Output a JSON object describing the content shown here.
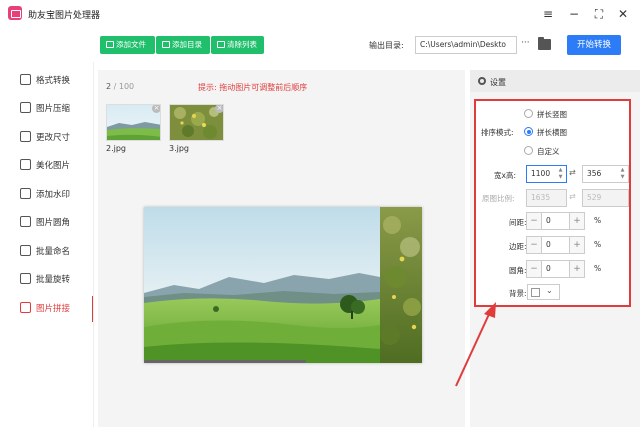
{
  "app": {
    "title": "助友宝图片处理器"
  },
  "window": {
    "menu_icon": "≡",
    "minimize_icon": "−",
    "maximize_icon": "⛶",
    "close_icon": "✕"
  },
  "sidebar": {
    "items": [
      {
        "label": "格式转换",
        "icon": "refresh-icon"
      },
      {
        "label": "图片压缩",
        "icon": "compress-icon"
      },
      {
        "label": "更改尺寸",
        "icon": "resize-icon"
      },
      {
        "label": "美化图片",
        "icon": "beautify-icon"
      },
      {
        "label": "添加水印",
        "icon": "watermark-icon"
      },
      {
        "label": "图片圆角",
        "icon": "rounded-corner-icon"
      },
      {
        "label": "批量命名",
        "icon": "rename-icon"
      },
      {
        "label": "批量旋转",
        "icon": "rotate-icon"
      },
      {
        "label": "图片拼接",
        "icon": "stitch-icon",
        "active": true
      }
    ]
  },
  "toolbar": {
    "add_file": "添加文件",
    "add_folder": "添加目录",
    "clear_list": "清除列表",
    "output_label": "输出目录:",
    "output_path": "C:\\Users\\admin\\Deskto",
    "more": "···",
    "start": "开始转换"
  },
  "main": {
    "count_current": "2",
    "count_total": " / 100",
    "hint": "提示: 拖动图片可调整前后顺序",
    "thumbs": [
      {
        "name": "2.jpg"
      },
      {
        "name": "3.jpg"
      }
    ]
  },
  "settings": {
    "title": "设置",
    "order_label": "排序模式:",
    "options": [
      "拼长竖图",
      "拼长横图",
      "自定义"
    ],
    "selected_option": "拼长横图",
    "size_label": "宽x高:",
    "width": "1100",
    "height": "356",
    "ratio_label": "原图比例:",
    "ratio_width": "1635",
    "ratio_height": "529",
    "spacing_label": "间距:",
    "spacing": "0",
    "margin_label": "边距:",
    "margin": "0",
    "radius_label": "圆角:",
    "radius": "0",
    "percent": "%",
    "background_label": "背景:",
    "background_color": "#ffffff"
  },
  "colors": {
    "accent_green": "#1fbf6b",
    "accent_blue": "#2b7cf6",
    "highlight_red": "#e03c3c"
  }
}
